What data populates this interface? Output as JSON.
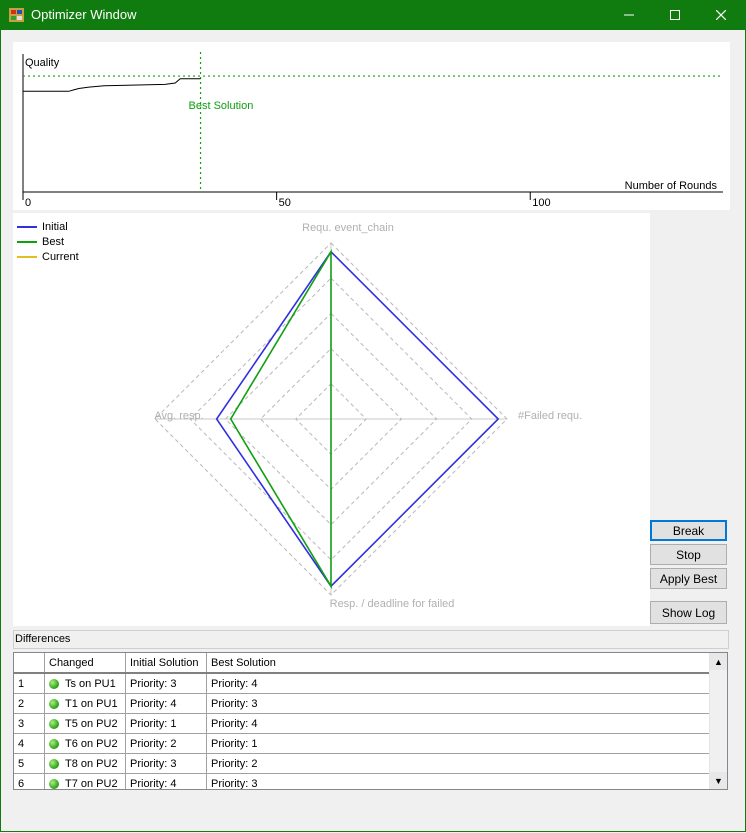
{
  "window": {
    "title": "Optimizer Window",
    "controls": {
      "minimize": "—",
      "maximize": "☐",
      "close": "✕"
    },
    "colors": {
      "titlebar": "#107c10"
    }
  },
  "progress_chart": {
    "ylabel": "Quality",
    "xlabel": "Number of Rounds",
    "ticks": [
      "0",
      "50",
      "100"
    ],
    "marker_label": "Best Solution",
    "tick_values": [
      0,
      50,
      100
    ],
    "x_max": 138,
    "best_round": 35,
    "quality_series": [
      [
        0,
        0.27
      ],
      [
        9,
        0.27
      ],
      [
        10,
        0.26
      ],
      [
        11,
        0.25
      ],
      [
        13,
        0.24
      ],
      [
        16,
        0.23
      ],
      [
        28,
        0.22
      ],
      [
        30,
        0.21
      ],
      [
        31,
        0.18
      ],
      [
        35,
        0.18
      ]
    ],
    "best_quality": 0.16
  },
  "radar_chart": {
    "axes": [
      "Requ. event_chain",
      "#Failed requ.",
      "Resp. / deadline for failed",
      "Avg. resp."
    ],
    "legend": [
      {
        "name": "Initial",
        "color": "#3030e0"
      },
      {
        "name": "Best",
        "color": "#10a010"
      },
      {
        "name": "Current",
        "color": "#e0c020"
      }
    ],
    "series": [
      {
        "name": "Initial",
        "values": [
          0.95,
          0.95,
          0.95,
          0.65
        ]
      },
      {
        "name": "Best",
        "values": [
          0.95,
          0.0,
          0.95,
          0.57
        ]
      }
    ]
  },
  "buttons": {
    "break": "Break",
    "stop": "Stop",
    "apply_best": "Apply Best",
    "show_log": "Show Log"
  },
  "differences": {
    "label": "Differences",
    "columns": [
      "Changed",
      "Initial Solution",
      "Best Solution"
    ],
    "rows": [
      {
        "n": "1",
        "changed": "Ts on PU1",
        "initial": "Priority: 3",
        "best": "Priority: 4"
      },
      {
        "n": "2",
        "changed": "T1 on PU1",
        "initial": "Priority: 4",
        "best": "Priority: 3"
      },
      {
        "n": "3",
        "changed": "T5 on PU2",
        "initial": "Priority: 1",
        "best": "Priority: 4"
      },
      {
        "n": "4",
        "changed": "T6 on PU2",
        "initial": "Priority: 2",
        "best": "Priority: 1"
      },
      {
        "n": "5",
        "changed": "T8 on PU2",
        "initial": "Priority: 3",
        "best": "Priority: 2"
      },
      {
        "n": "6",
        "changed": "T7 on PU2",
        "initial": "Priority: 4",
        "best": "Priority: 3"
      }
    ]
  }
}
